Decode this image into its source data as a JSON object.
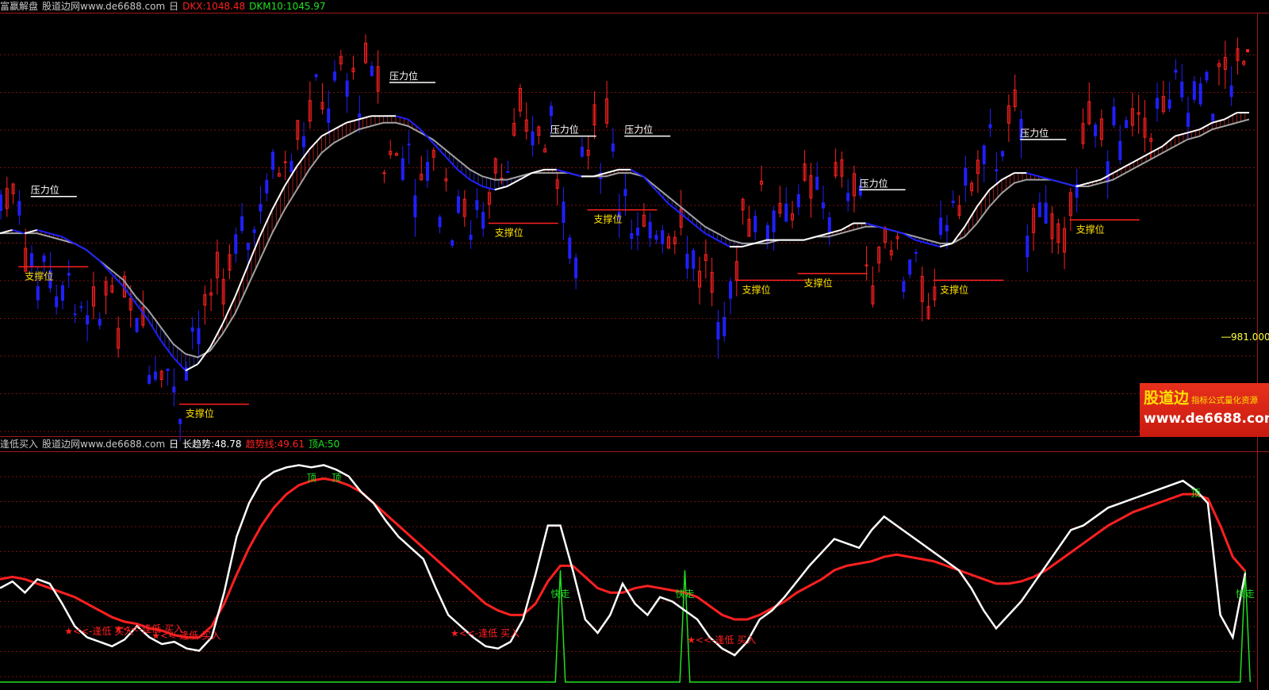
{
  "top_panel": {
    "name": "富赢解盘",
    "site": "股道边网www.de6688.com",
    "period": "日",
    "dkx": "DKX:1048.48",
    "dkm": "DKM10:1045.97"
  },
  "bottom_panel": {
    "name": "逢低买入",
    "site": "股道边网www.de6688.com",
    "period": "日",
    "long_trend": "长趋势:48.78",
    "trend_line": "趋势线:49.61",
    "top_a": "顶A:50"
  },
  "price_label": "981.000",
  "brand": {
    "name": "股道边",
    "tagline": "指标公式量化资源",
    "url": "www.de6688.com"
  },
  "annotations": {
    "resistance": "压力位",
    "support": "支撑位",
    "top": "顶",
    "run": "快走",
    "buy_low": "★<<-逢低  买入",
    "buy_short": "逢低  买"
  },
  "colors": {
    "background": "#000000",
    "grid": "#7a1010",
    "up_candle": "#ff2020",
    "down_candle": "#2020ff",
    "dkx_up": "#ffffff",
    "dkx_down": "#2020ff",
    "dkm": "#a0a0a0",
    "support_line": "#ff2020",
    "resistance_line": "#ffffff",
    "support_text": "#ffe000",
    "resistance_text": "#ffffff",
    "long_trend_line": "#ffffff",
    "trend_line": "#ff2020",
    "top_line": "#20e020"
  },
  "chart_data": [
    {
      "type": "candlestick",
      "title": "富赢解盘",
      "series": [
        {
          "name": "DKX",
          "values": [
            1012,
            1013,
            1012,
            1013,
            1012,
            1011,
            1009,
            1007,
            1004,
            1000,
            996,
            991,
            986,
            980,
            975,
            971,
            973,
            978,
            985,
            993,
            1002,
            1011,
            1019,
            1026,
            1032,
            1037,
            1041,
            1043,
            1045,
            1046,
            1047,
            1047,
            1047,
            1046,
            1043,
            1039,
            1035,
            1031,
            1028,
            1026,
            1025,
            1026,
            1028,
            1030,
            1031,
            1031,
            1030,
            1029,
            1029,
            1030,
            1031,
            1031,
            1029,
            1025,
            1021,
            1018,
            1015,
            1012,
            1010,
            1008,
            1008,
            1009,
            1010,
            1010,
            1010,
            1010,
            1011,
            1012,
            1013,
            1015,
            1015,
            1014,
            1013,
            1012,
            1010,
            1009,
            1008,
            1009,
            1014,
            1020,
            1025,
            1028,
            1030,
            1030,
            1029,
            1028,
            1027,
            1026,
            1027,
            1028,
            1030,
            1032,
            1034,
            1036,
            1038,
            1041,
            1042,
            1043,
            1045,
            1046,
            1048,
            1048
          ]
        },
        {
          "name": "DKM10",
          "values": [
            1012,
            1012,
            1012,
            1012,
            1011,
            1010,
            1009,
            1007,
            1004,
            1001,
            998,
            993,
            989,
            984,
            979,
            976,
            975,
            977,
            982,
            988,
            996,
            1004,
            1012,
            1019,
            1025,
            1031,
            1036,
            1039,
            1041,
            1043,
            1044,
            1045,
            1045,
            1044,
            1042,
            1040,
            1037,
            1034,
            1031,
            1029,
            1028,
            1028,
            1029,
            1030,
            1030,
            1030,
            1030,
            1029,
            1029,
            1029,
            1030,
            1030,
            1029,
            1026,
            1023,
            1020,
            1017,
            1014,
            1012,
            1010,
            1009,
            1009,
            1009,
            1010,
            1010,
            1010,
            1011,
            1011,
            1012,
            1013,
            1014,
            1014,
            1013,
            1012,
            1011,
            1010,
            1009,
            1009,
            1011,
            1015,
            1020,
            1024,
            1027,
            1028,
            1028,
            1028,
            1027,
            1026,
            1026,
            1027,
            1028,
            1030,
            1032,
            1034,
            1036,
            1038,
            1040,
            1041,
            1043,
            1044,
            1045,
            1046
          ]
        }
      ],
      "last_price": "981.000",
      "annotations": [
        "压力位",
        "支撑位"
      ]
    },
    {
      "type": "line",
      "title": "逢低买入",
      "series": [
        {
          "name": "长趋势",
          "values": [
            42,
            45,
            40,
            46,
            44,
            35,
            25,
            20,
            18,
            16,
            19,
            25,
            20,
            17,
            18,
            15,
            14,
            20,
            40,
            65,
            80,
            90,
            94,
            96,
            97,
            96,
            97,
            95,
            92,
            85,
            80,
            72,
            65,
            60,
            55,
            42,
            30,
            25,
            20,
            16,
            15,
            18,
            28,
            48,
            70,
            70,
            50,
            28,
            22,
            30,
            44,
            35,
            30,
            38,
            36,
            32,
            28,
            20,
            15,
            12,
            18,
            28,
            32,
            38,
            45,
            52,
            58,
            64,
            62,
            60,
            68,
            74,
            70,
            66,
            62,
            58,
            54,
            50,
            42,
            32,
            24,
            30,
            36,
            44,
            52,
            60,
            68,
            70,
            74,
            78,
            80,
            82,
            84,
            86,
            88,
            90,
            86,
            80,
            30,
            20,
            48.78
          ]
        },
        {
          "name": "趋势线",
          "values": [
            46,
            47,
            46,
            44,
            42,
            40,
            38,
            35,
            32,
            29,
            27,
            26,
            24,
            23,
            21,
            20,
            20,
            25,
            35,
            48,
            60,
            70,
            78,
            84,
            88,
            90,
            91,
            90,
            88,
            85,
            80,
            75,
            70,
            65,
            60,
            55,
            50,
            45,
            40,
            35,
            32,
            30,
            30,
            35,
            45,
            52,
            52,
            47,
            42,
            40,
            40,
            42,
            43,
            42,
            41,
            40,
            38,
            34,
            30,
            28,
            28,
            30,
            33,
            36,
            40,
            43,
            46,
            50,
            52,
            53,
            54,
            56,
            57,
            56,
            55,
            54,
            52,
            50,
            48,
            46,
            44,
            44,
            45,
            47,
            50,
            54,
            58,
            62,
            66,
            70,
            73,
            76,
            78,
            80,
            82,
            84,
            84,
            82,
            70,
            56,
            49.61
          ]
        },
        {
          "name": "顶A",
          "values": [
            0,
            0,
            0,
            0,
            0,
            0,
            0,
            0,
            0,
            0,
            0,
            0,
            0,
            0,
            0,
            0,
            0,
            0,
            0,
            0,
            0,
            0,
            0,
            0,
            0,
            0,
            0,
            0,
            0,
            0,
            0,
            0,
            0,
            0,
            0,
            0,
            0,
            0,
            0,
            0,
            0,
            0,
            0,
            0,
            0,
            50,
            0,
            0,
            0,
            0,
            0,
            0,
            0,
            0,
            0,
            50,
            0,
            0,
            0,
            0,
            0,
            0,
            0,
            0,
            0,
            0,
            0,
            0,
            0,
            0,
            0,
            0,
            0,
            0,
            0,
            0,
            0,
            0,
            0,
            0,
            0,
            0,
            0,
            0,
            0,
            0,
            0,
            0,
            0,
            0,
            0,
            0,
            0,
            0,
            0,
            0,
            0,
            0,
            0,
            0,
            50
          ]
        }
      ],
      "annotations": [
        "顶",
        "快走",
        "★<<-逢低  买入"
      ]
    }
  ]
}
